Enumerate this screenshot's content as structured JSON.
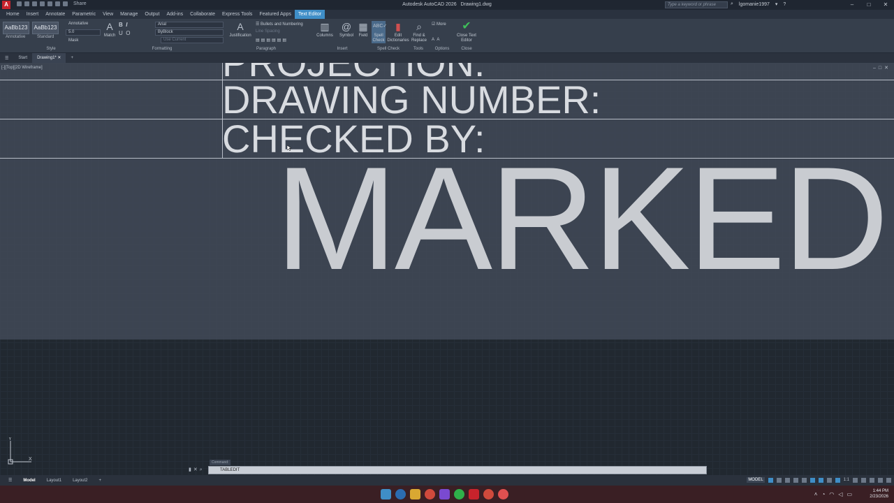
{
  "window": {
    "app_logo": "A",
    "title": "Autodesk AutoCAD 2026",
    "file": "Drawing1.dwg",
    "search_placeholder": "Type a keyword or phrase",
    "user": "lgomanie1997",
    "share_label": "Share"
  },
  "ribbon_tabs": [
    "Home",
    "Insert",
    "Annotate",
    "Parametric",
    "View",
    "Manage",
    "Output",
    "Add-ins",
    "Collaborate",
    "Express Tools",
    "Featured Apps",
    "Text Editor"
  ],
  "ribbon": {
    "style": {
      "swatch1": "AaBb123",
      "swatch1_label": "Annotative",
      "swatch2": "AaBb123",
      "swatch2_label": "Standard",
      "annotative": "Annotative",
      "height": "5.0",
      "mask": "Mask",
      "panel": "Style"
    },
    "formatting": {
      "match": "Match",
      "font": "Arial",
      "color": "ByBlock",
      "bg": "Use Current",
      "panel": "Formatting"
    },
    "paragraph": {
      "justification": "Justification",
      "bullets": "Bullets and Numbering",
      "line_spacing": "Line Spacing",
      "panel": "Paragraph"
    },
    "insert": {
      "columns": "Columns",
      "symbol": "Symbol",
      "field": "Field",
      "panel": "Insert"
    },
    "spell": {
      "spell_check": "Spell Check",
      "edit_dict": "Edit Dictionaries",
      "panel": "Spell Check"
    },
    "tools": {
      "find": "Find & Replace",
      "panel": "Tools"
    },
    "options": {
      "more": "More",
      "panel": "Options"
    },
    "close": {
      "label": "Close Text Editor",
      "panel": "Close"
    }
  },
  "doc_tabs": [
    "Start",
    "Drawing1*"
  ],
  "viewport": {
    "label": "[-][Top][2D Wireframe]",
    "rows": [
      "PROJECTION:",
      "DRAWING NUMBER:",
      "CHECKED BY:"
    ],
    "marked": "MARKED"
  },
  "command": {
    "history": "Command:",
    "current": "TABLEDIT"
  },
  "layouts": [
    "Model",
    "Layout1",
    "Layout2"
  ],
  "status": {
    "model": "MODEL",
    "scale": "1:1"
  },
  "clock": {
    "time": "1:44 PM",
    "date": "2/23/2026"
  },
  "colors": {
    "accent": "#3f8ec7",
    "app_red": "#c8232c",
    "close_green": "#3fbf5a"
  }
}
